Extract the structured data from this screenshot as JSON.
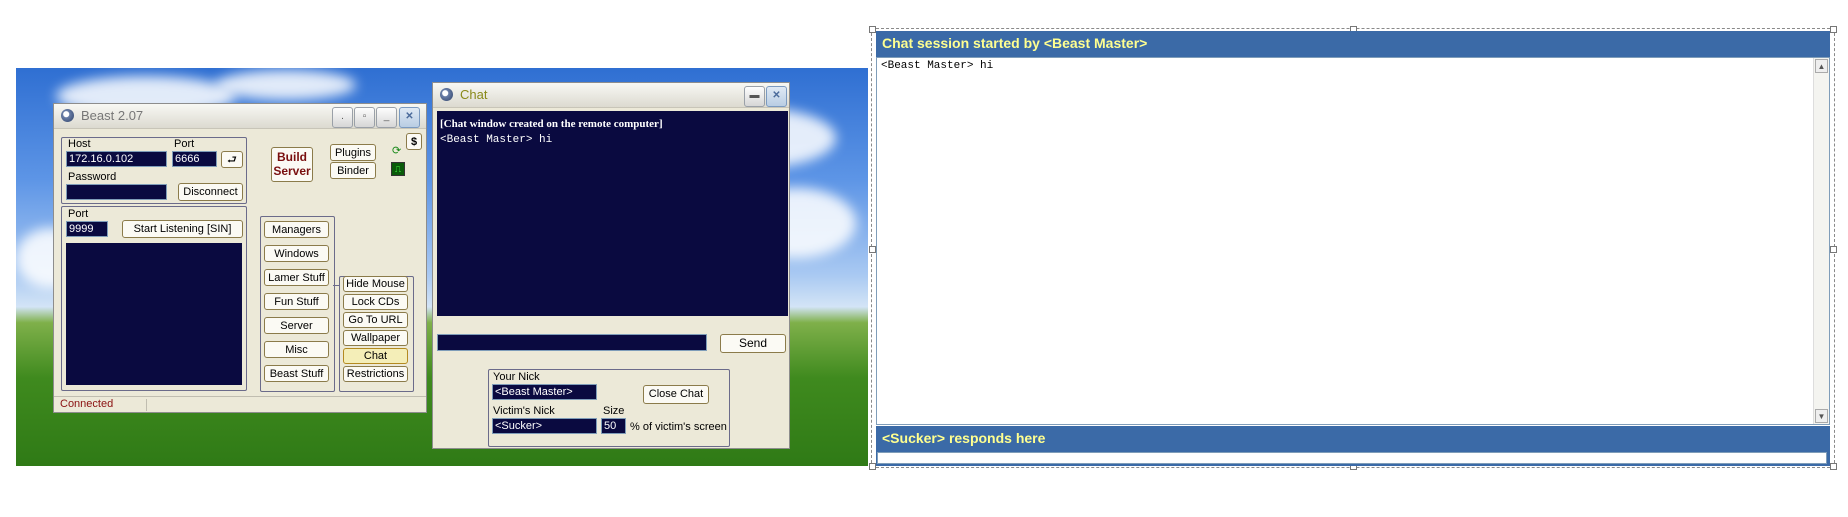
{
  "beast_window": {
    "title": "Beast 2.07",
    "host_label": "Host",
    "host_value": "172.16.0.102",
    "port_label": "Port",
    "port_value": "6666",
    "password_label": "Password",
    "password_value": "",
    "disconnect_label": "Disconnect",
    "listen_port_label": "Port",
    "listen_port_value": "9999",
    "start_listening_label": "Start Listening [SIN]",
    "build_server_label": "Build\nServer",
    "plugins_label": "Plugins",
    "binder_label": "Binder",
    "menu_items": [
      "Managers",
      "Windows",
      "Lamer Stuff",
      "Fun Stuff",
      "Server",
      "Misc",
      "Beast Stuff"
    ],
    "fun_items": [
      "Hide Mouse",
      "Lock CDs",
      "Go To URL",
      "Wallpaper",
      "Chat",
      "Restrictions"
    ],
    "status": "Connected",
    "dollar_glyph": "$"
  },
  "chat_window": {
    "title": "Chat",
    "lines": [
      "[Chat window created on the remote computer]",
      "<Beast Master> hi"
    ],
    "message_input": "",
    "send_label": "Send",
    "your_nick_label": "Your Nick",
    "your_nick_value": "<Beast Master>",
    "victim_nick_label": "Victim's Nick",
    "victim_nick_value": "<Sucker>",
    "size_label": "Size",
    "size_value": "50",
    "size_suffix": "% of victim's screen",
    "close_chat_label": "Close Chat"
  },
  "remote_chat": {
    "header": "Chat session started by <Beast Master>",
    "lines": [
      "<Beast Master> hi"
    ],
    "responds_label": "<Sucker>  responds here",
    "response_input": ""
  },
  "colors": {
    "navy_field": "#0a0a40",
    "header_blue": "#3b6aa7",
    "header_text": "#ffff90"
  }
}
